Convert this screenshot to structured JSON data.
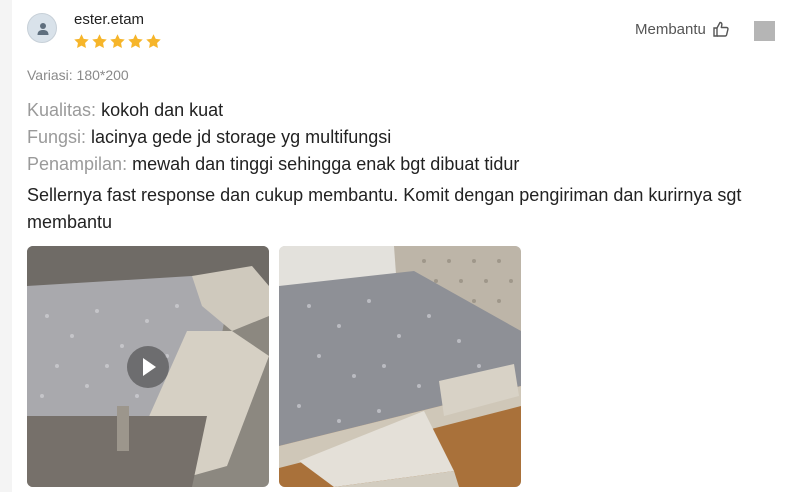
{
  "review": {
    "username": "ester.etam",
    "rating": 5,
    "rating_max": 5,
    "helpful_label": "Membantu",
    "variant": "Variasi: 180*200",
    "attributes": [
      {
        "label": "Kualitas:",
        "value": "kokoh dan kuat"
      },
      {
        "label": "Fungsi:",
        "value": "lacinya gede jd storage yg multifungsi"
      },
      {
        "label": "Penampilan:",
        "value": "mewah dan tinggi sehingga enak bgt dibuat tidur"
      }
    ],
    "text": "Sellernya fast response dan cukup membantu. Komit dengan pengiriman dan kurirnya sgt membantu",
    "media": [
      {
        "type": "video",
        "icon": "play-icon"
      },
      {
        "type": "photo"
      }
    ]
  },
  "colors": {
    "star": "#f6b52a",
    "label": "#9a9a9a",
    "text": "#222222",
    "variant": "#8a8a8a"
  },
  "icons": {
    "avatar": "user-icon",
    "helpful": "thumbs-up-icon",
    "more": "more-icon"
  }
}
